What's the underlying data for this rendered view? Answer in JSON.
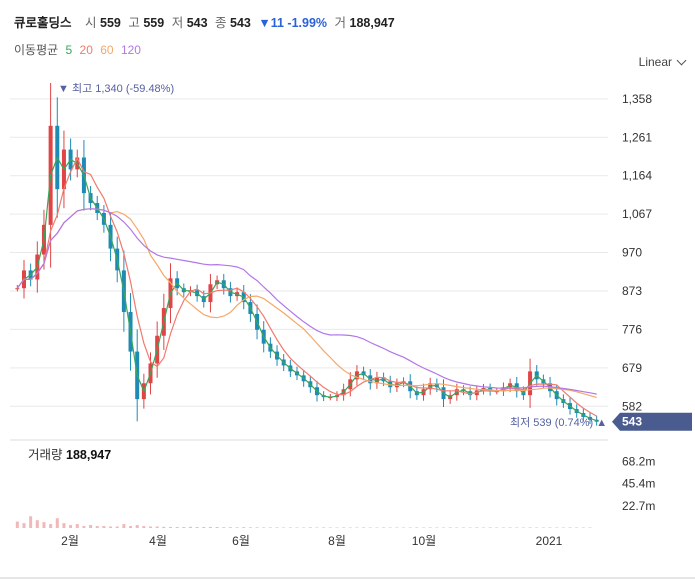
{
  "header": {
    "name": "큐로홀딩스",
    "open_label": "시",
    "open": "559",
    "high_label": "고",
    "high": "559",
    "low_label": "저",
    "low": "543",
    "close_label": "종",
    "close": "543",
    "change": "▼11 -1.99%",
    "volume_label": "거",
    "volume": "188,947"
  },
  "ma_legend": {
    "label": "이동평균",
    "p5": "5",
    "p20": "20",
    "p60": "60",
    "p120": "120"
  },
  "scale_button": "Linear",
  "colors": {
    "up": "#e04444",
    "down": "#1e8bb5",
    "ma5": "#3aa55c",
    "ma20": "#f07b6e",
    "ma60": "#f5a86a",
    "ma120": "#b277e8",
    "current_tag": "#4a5b8f",
    "annotation": "#5561a1",
    "grid": "#e9e9e9",
    "volume": "#f2b7b7"
  },
  "chart_data": {
    "type": "candlestick",
    "y_ticks": [
      "1,358",
      "1,261",
      "1,164",
      "1,067",
      "970",
      "873",
      "776",
      "679",
      "582"
    ],
    "y_range": [
      517,
      1393
    ],
    "x_ticks": [
      "2월",
      "4월",
      "6월",
      "8월",
      "10월",
      "2021"
    ],
    "current_price": "543",
    "high_annotation": "최고 1,340 (-59.48%)",
    "low_annotation": "최저 539 (0.74%)",
    "close_series": [
      880,
      925,
      902,
      965,
      1040,
      1290,
      1130,
      1230,
      1180,
      1210,
      1120,
      1095,
      1070,
      1040,
      980,
      925,
      820,
      720,
      600,
      640,
      690,
      760,
      830,
      905,
      880,
      870,
      875,
      860,
      845,
      890,
      900,
      880,
      860,
      870,
      845,
      815,
      775,
      740,
      720,
      700,
      685,
      670,
      660,
      645,
      630,
      610,
      605,
      605,
      610,
      625,
      650,
      670,
      660,
      640,
      655,
      645,
      630,
      640,
      645,
      620,
      610,
      625,
      640,
      630,
      600,
      610,
      625,
      620,
      610,
      622,
      628,
      620,
      620,
      630,
      640,
      620,
      610,
      670,
      650,
      640,
      620,
      600,
      590,
      575,
      565,
      555,
      548,
      543
    ],
    "ma_series": [
      {
        "name": "5",
        "period": 5
      },
      {
        "name": "20",
        "period": 20
      },
      {
        "name": "60",
        "period": 60
      },
      {
        "name": "120",
        "period": 120
      }
    ],
    "volume": {
      "title": "거래량",
      "value": "188,947",
      "y_ticks": [
        "68.2m",
        "45.4m",
        "22.7m"
      ],
      "y_max": 90.0,
      "bars_m": [
        6.6,
        5,
        12,
        8,
        6,
        4,
        10,
        5,
        3,
        4,
        2,
        3,
        2,
        2,
        1.5,
        1.5,
        4,
        2,
        3,
        2,
        1.5,
        1.5,
        1.2,
        1,
        1,
        1,
        1.2,
        1,
        1,
        1,
        1,
        0.8,
        0.8,
        0.7,
        0.9,
        0.7,
        0.7,
        0.6,
        0.6,
        0.6,
        0.5,
        0.6,
        0.5,
        0.5,
        0.7,
        0.5,
        0.6,
        0.5,
        0.5,
        0.6,
        0.5,
        0.5,
        0.6,
        0.5,
        0.5,
        0.6,
        0.5,
        0.5,
        0.5,
        0.5,
        0.6,
        0.5,
        0.6,
        0.5,
        0.5,
        0.6,
        0.5,
        0.5,
        0.5,
        0.6,
        0.5,
        0.6,
        0.5,
        0.5,
        0.6,
        0.5,
        0.5,
        0.6,
        0.5,
        0.5,
        0.6,
        0.5,
        0.5,
        0.6,
        0.5,
        0.5,
        0.5
      ]
    }
  }
}
